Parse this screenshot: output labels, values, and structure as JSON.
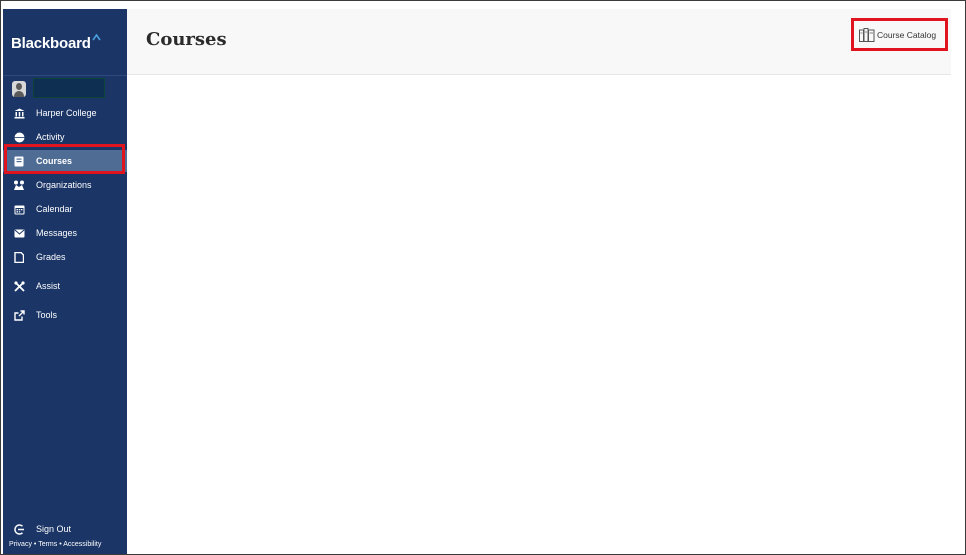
{
  "app": {
    "logo_text": "Blackboard",
    "logo_mark": "^"
  },
  "sidebar": {
    "items": [
      {
        "label": "Harper College",
        "icon": "institution-icon"
      },
      {
        "label": "Activity",
        "icon": "globe-icon"
      },
      {
        "label": "Courses",
        "icon": "book-icon",
        "active": true
      },
      {
        "label": "Organizations",
        "icon": "organizations-icon"
      },
      {
        "label": "Calendar",
        "icon": "calendar-icon"
      },
      {
        "label": "Messages",
        "icon": "envelope-icon"
      },
      {
        "label": "Grades",
        "icon": "grades-icon"
      },
      {
        "label": "Assist",
        "icon": "tools-cross-icon"
      },
      {
        "label": "Tools",
        "icon": "external-link-icon"
      }
    ],
    "sign_out": "Sign Out",
    "footer": {
      "privacy": "Privacy",
      "sep": "•",
      "terms": "Terms",
      "accessibility": "Accessibility"
    }
  },
  "header": {
    "title": "Courses",
    "course_catalog_label": "Course Catalog",
    "course_catalog_icon": "books-icon"
  },
  "colors": {
    "sidebar_bg": "#1a3566",
    "active_item_bg": "#4f6d94",
    "highlight_red": "#e0141e",
    "header_bg": "#f8f8f8"
  }
}
